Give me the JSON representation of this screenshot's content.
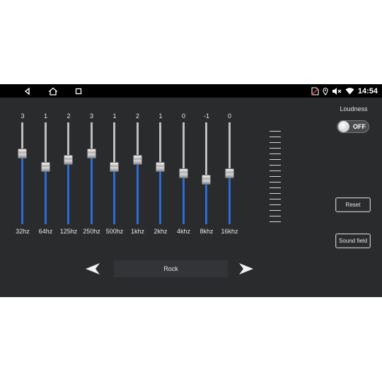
{
  "statusbar": {
    "time": "14:54",
    "icons": [
      "back-icon",
      "home-icon",
      "recents-icon",
      "no-sim-icon",
      "location-icon",
      "mute-icon",
      "wifi-icon"
    ]
  },
  "equalizer": {
    "bands": [
      {
        "label": "32hz",
        "value": "3",
        "level": 3
      },
      {
        "label": "64hz",
        "value": "1",
        "level": 1
      },
      {
        "label": "125hz",
        "value": "2",
        "level": 2
      },
      {
        "label": "250hz",
        "value": "3",
        "level": 3
      },
      {
        "label": "500hz",
        "value": "1",
        "level": 1
      },
      {
        "label": "1khz",
        "value": "2",
        "level": 2
      },
      {
        "label": "2khz",
        "value": "1",
        "level": 1
      },
      {
        "label": "4khz",
        "value": "0",
        "level": 0
      },
      {
        "label": "8khz",
        "value": "-1",
        "level": -1
      },
      {
        "label": "16khz",
        "value": "0",
        "level": 0
      }
    ],
    "range": [
      -7,
      7
    ],
    "accent_color": "#2d6cd6"
  },
  "loudness": {
    "label": "Loudness",
    "state": "OFF"
  },
  "buttons": {
    "reset": "Reset",
    "sound_field": "Sound field"
  },
  "preset": {
    "name": "Rock"
  }
}
